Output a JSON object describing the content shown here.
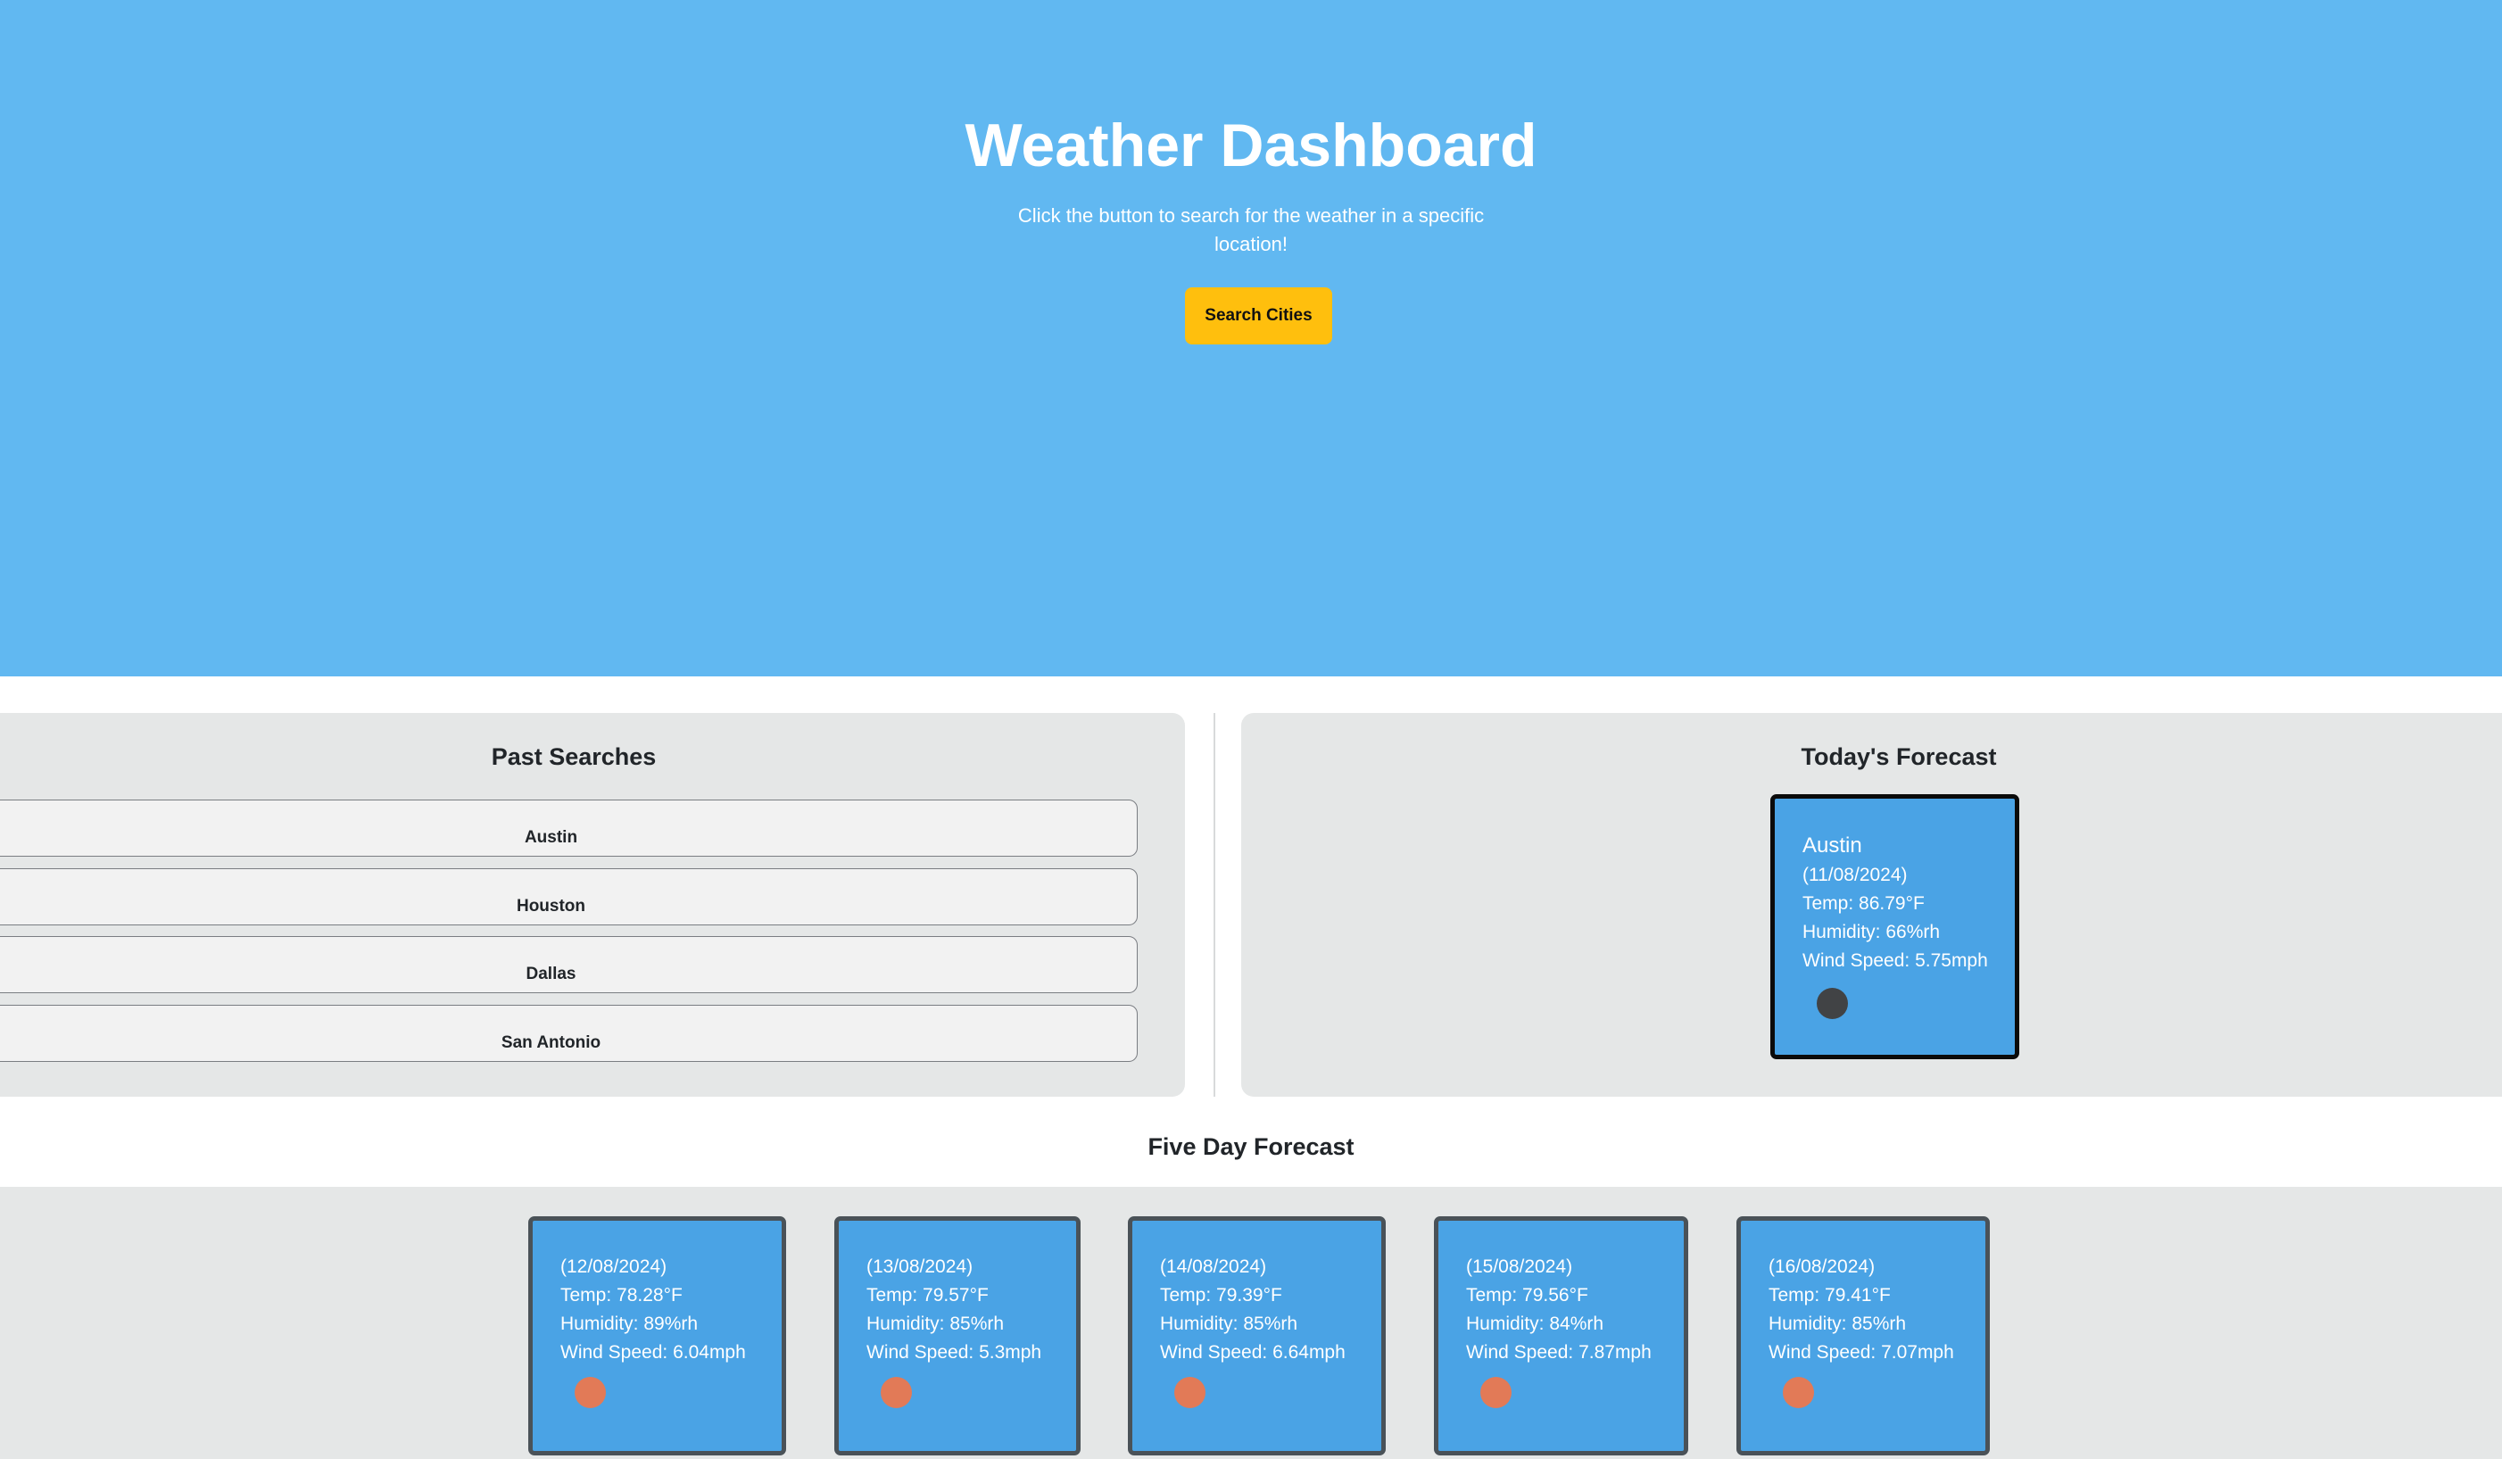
{
  "header": {
    "title": "Weather Dashboard",
    "subtitle": "Click the button to search for the weather in a specific location!",
    "search_button_label": "Search Cities"
  },
  "past_searches": {
    "title": "Past Searches",
    "cities": [
      "Austin",
      "Houston",
      "Dallas",
      "San Antonio"
    ]
  },
  "today": {
    "title": "Today's Forecast",
    "city": "Austin",
    "date": "(11/08/2024)",
    "temp": "Temp: 86.79°F",
    "humidity": "Humidity: 66%rh",
    "wind": "Wind Speed: 5.75mph",
    "icon": "weather-icon"
  },
  "five_day": {
    "title": "Five Day Forecast",
    "days": [
      {
        "date": "(12/08/2024)",
        "temp": "Temp: 78.28°F",
        "humidity": "Humidity: 89%rh",
        "wind": "Wind Speed: 6.04mph",
        "icon": "weather-icon"
      },
      {
        "date": "(13/08/2024)",
        "temp": "Temp: 79.57°F",
        "humidity": "Humidity: 85%rh",
        "wind": "Wind Speed: 5.3mph",
        "icon": "weather-icon"
      },
      {
        "date": "(14/08/2024)",
        "temp": "Temp: 79.39°F",
        "humidity": "Humidity: 85%rh",
        "wind": "Wind Speed: 6.64mph",
        "icon": "weather-icon"
      },
      {
        "date": "(15/08/2024)",
        "temp": "Temp: 79.56°F",
        "humidity": "Humidity: 84%rh",
        "wind": "Wind Speed: 7.87mph",
        "icon": "weather-icon"
      },
      {
        "date": "(16/08/2024)",
        "temp": "Temp: 79.41°F",
        "humidity": "Humidity: 85%rh",
        "wind": "Wind Speed: 7.07mph",
        "icon": "weather-icon"
      }
    ]
  },
  "colors": {
    "hero_background": "#61b8f1",
    "search_button": "#ffbf0d",
    "card_background": "#4aa3e5",
    "panel_background": "#e5e7e7"
  }
}
